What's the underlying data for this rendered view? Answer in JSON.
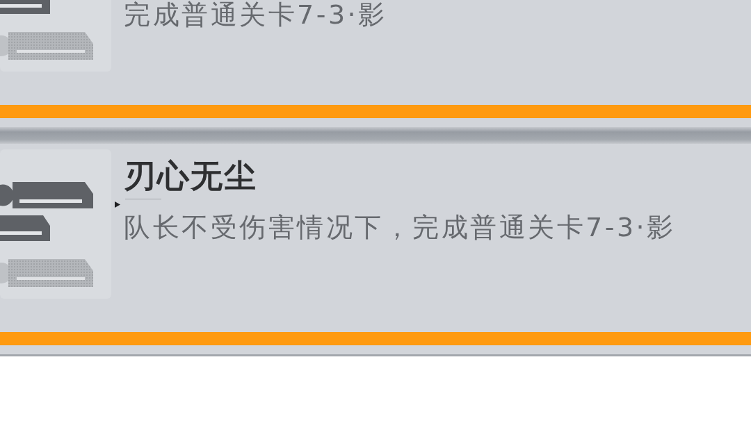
{
  "achievements": [
    {
      "description": "完成普通关卡7-3·影"
    },
    {
      "title": "刃心无尘",
      "description": "队长不受伤害情况下，完成普通关卡7-3·影"
    }
  ]
}
